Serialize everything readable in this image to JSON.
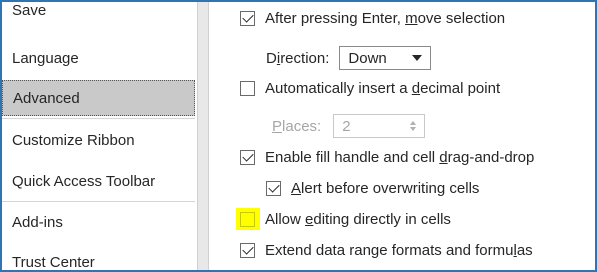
{
  "sidebar": {
    "items": [
      {
        "label": "Save"
      },
      {
        "label": "Language"
      },
      {
        "label": "Advanced"
      },
      {
        "label": "Customize Ribbon"
      },
      {
        "label": "Quick Access Toolbar"
      },
      {
        "label": "Add-ins"
      },
      {
        "label": "Trust Center"
      }
    ],
    "selected": "Advanced"
  },
  "editing_options": {
    "after_enter": {
      "label_pre": "After pressing Enter, ",
      "label_u": "m",
      "label_post": "ove selection",
      "checked": true
    },
    "direction": {
      "label_pre": "D",
      "label_u": "i",
      "label_post": "rection:",
      "value": "Down"
    },
    "decimal_point": {
      "label_pre": "Automatically insert a ",
      "label_u": "d",
      "label_post": "ecimal point",
      "checked": false
    },
    "places": {
      "label_u": "P",
      "label_post": "laces:",
      "value": "2"
    },
    "fill_handle": {
      "label_pre": "Enable fill handle and cell ",
      "label_u": "d",
      "label_post": "rag-and-drop",
      "checked": true
    },
    "alert_overwrite": {
      "label_u": "A",
      "label_post": "lert before overwriting cells",
      "checked": true
    },
    "edit_in_cells": {
      "label_pre": "Allow ",
      "label_u": "e",
      "label_post": "diting directly in cells",
      "checked": false,
      "highlight_color": "#ffff00"
    },
    "extend_formats": {
      "label_pre": "Extend data range formats and formu",
      "label_u": "l",
      "label_post": "as",
      "checked": true
    }
  }
}
